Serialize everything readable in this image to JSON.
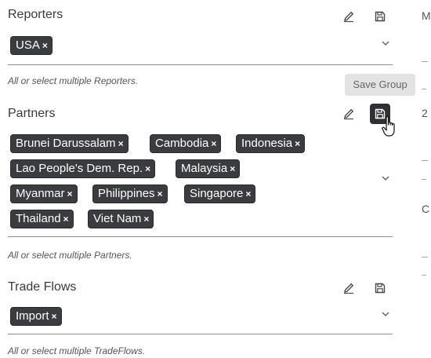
{
  "reporters": {
    "label": "Reporters",
    "chips": [
      "USA"
    ],
    "hint": "All or select multiple Reporters."
  },
  "partners": {
    "label": "Partners",
    "chips": [
      "Brunei Darussalam",
      "Cambodia",
      "Indonesia",
      "Lao People's Dem. Rep.",
      "Malaysia",
      "Myanmar",
      "Philippines",
      "Singapore",
      "Thailand",
      "Viet Nam"
    ],
    "hint": "All or select multiple Partners."
  },
  "trade_flows": {
    "label": "Trade Flows",
    "chips": [
      "Import"
    ],
    "hint": "All or select multiple TradeFlows."
  },
  "tooltip": {
    "save_group": "Save Group"
  },
  "chip_remove_glyph": "×",
  "right_edge_fragments": [
    "M",
    "2",
    "C"
  ],
  "icons": {
    "edit": "pencil-icon",
    "save": "floppy-disk-icon",
    "dropdown": "chevron-down-icon",
    "remove": "close-icon"
  },
  "colors": {
    "chip_bg": "#3b3c3f",
    "chip_text": "#ffffff",
    "tooltip_bg": "#e3e3e3",
    "underline": "#8e8e8e",
    "active_button_bg": "#2f3035"
  }
}
